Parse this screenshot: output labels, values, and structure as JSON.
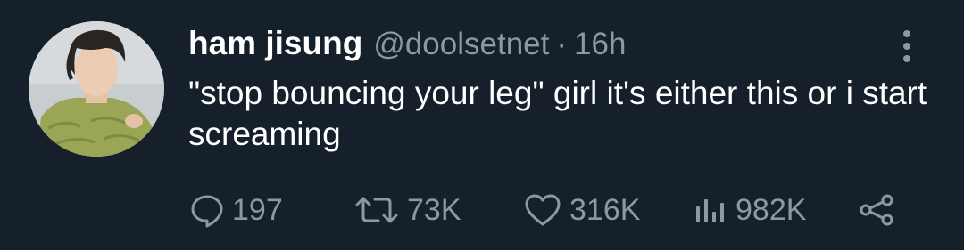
{
  "tweet": {
    "author_name": "ham jisung",
    "handle": "@doolsetnet",
    "separator": "·",
    "time": "16h",
    "text": "\"stop bouncing your leg\" girl it's either this or i start screaming"
  },
  "actions": {
    "replies": "197",
    "retweets": "73K",
    "likes": "316K",
    "views": "982K"
  },
  "colors": {
    "background": "#15202b",
    "text": "#ffffff",
    "secondary": "#8b98a5"
  },
  "icons": [
    "more-vertical-icon",
    "reply-icon",
    "retweet-icon",
    "like-icon",
    "views-icon",
    "share-icon"
  ]
}
